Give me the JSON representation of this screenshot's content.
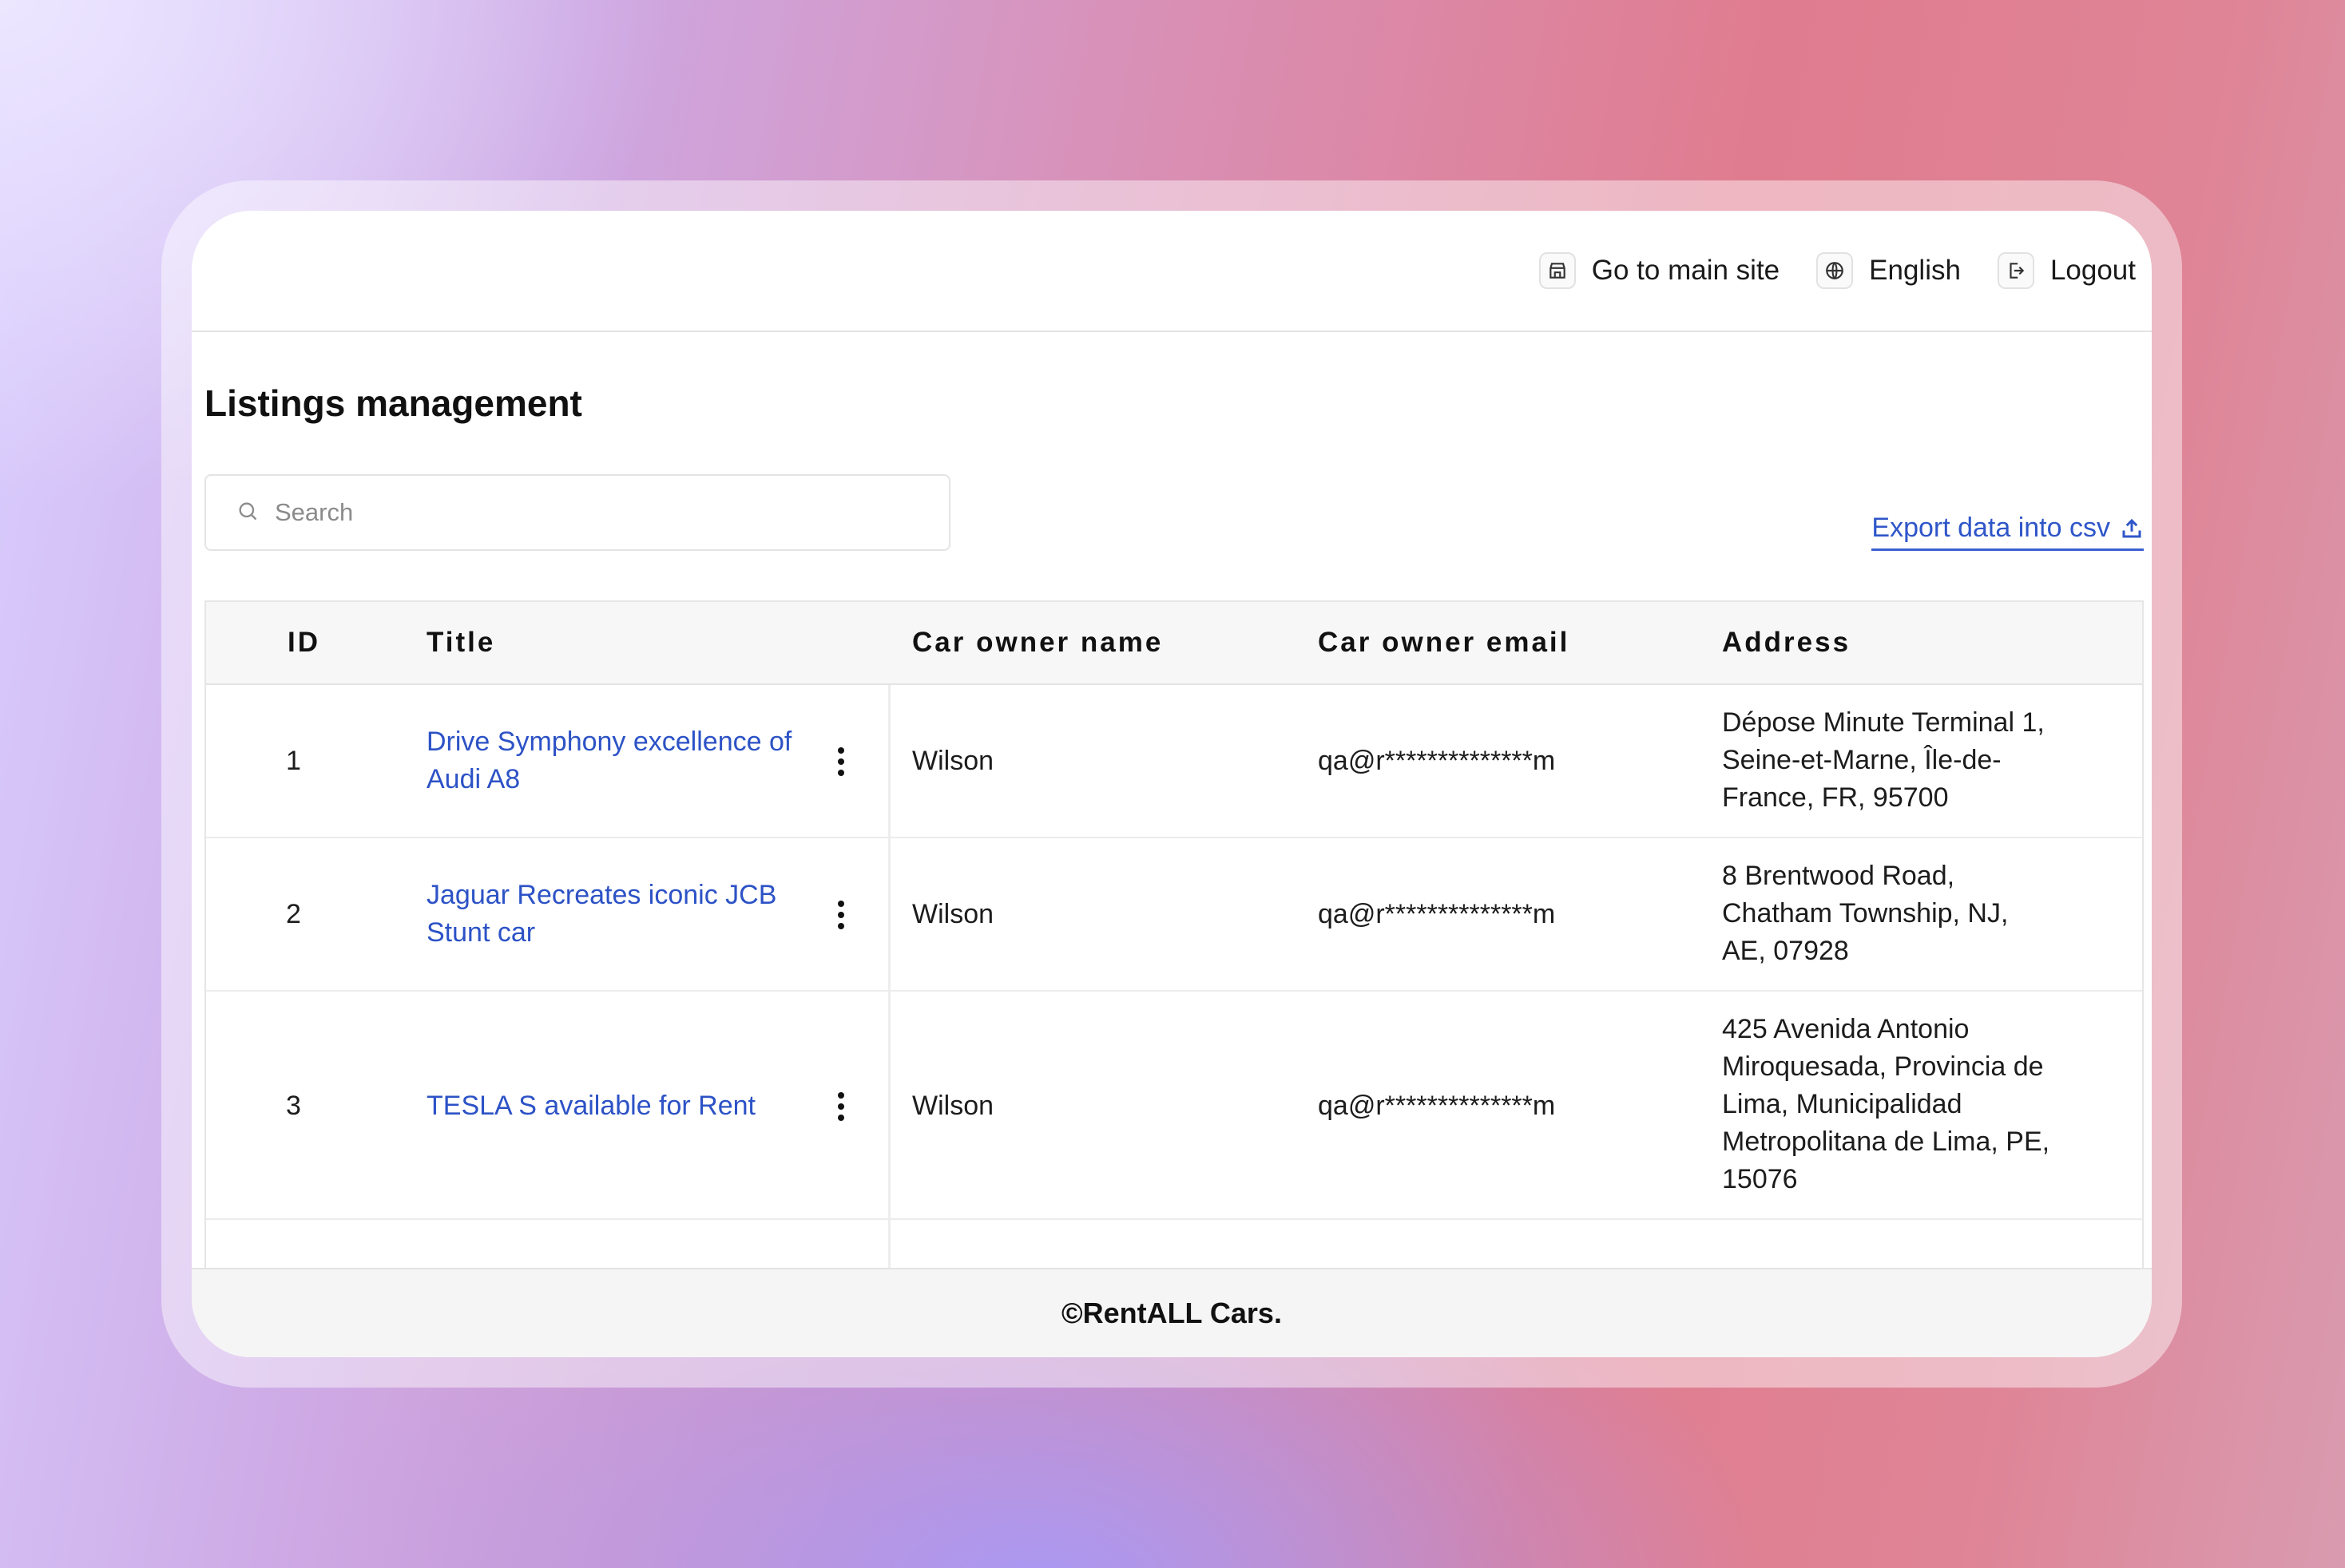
{
  "header": {
    "nav": [
      {
        "label": "Go to main site",
        "icon": "storefront-icon"
      },
      {
        "label": "English",
        "icon": "globe-icon"
      },
      {
        "label": "Logout",
        "icon": "logout-icon"
      }
    ]
  },
  "page": {
    "title": "Listings management",
    "search_placeholder": "Search",
    "export_label": "Export data into csv"
  },
  "table": {
    "columns": [
      "ID",
      "Title",
      "Car owner name",
      "Car owner email",
      "Address"
    ],
    "rows": [
      {
        "id": "1",
        "title_lines": [
          "Drive Symphony excellence of",
          "Audi A8"
        ],
        "owner": "Wilson",
        "email": "qa@r**************m",
        "address_lines": [
          "Dépose Minute Terminal 1,",
          "Seine-et-Marne, Île-de-",
          "France, FR, 95700"
        ]
      },
      {
        "id": "2",
        "title_lines": [
          "Jaguar Recreates iconic JCB",
          "Stunt car"
        ],
        "owner": "Wilson",
        "email": "qa@r**************m",
        "address_lines": [
          "8 Brentwood Road,",
          "Chatham Township, NJ,",
          "AE, 07928"
        ]
      },
      {
        "id": "3",
        "title_lines": [
          "TESLA S available for Rent"
        ],
        "owner": "Wilson",
        "email": "qa@r**************m",
        "address_lines": [
          "425 Avenida Antonio",
          "Miroquesada, Provincia de",
          "Lima, Municipalidad",
          "Metropolitana de Lima, PE,",
          "15076"
        ]
      }
    ]
  },
  "footer": {
    "text": "©RentALL Cars."
  },
  "colors": {
    "accent": "#2f56c9",
    "text": "#111111",
    "border": "#e3e3e3"
  }
}
